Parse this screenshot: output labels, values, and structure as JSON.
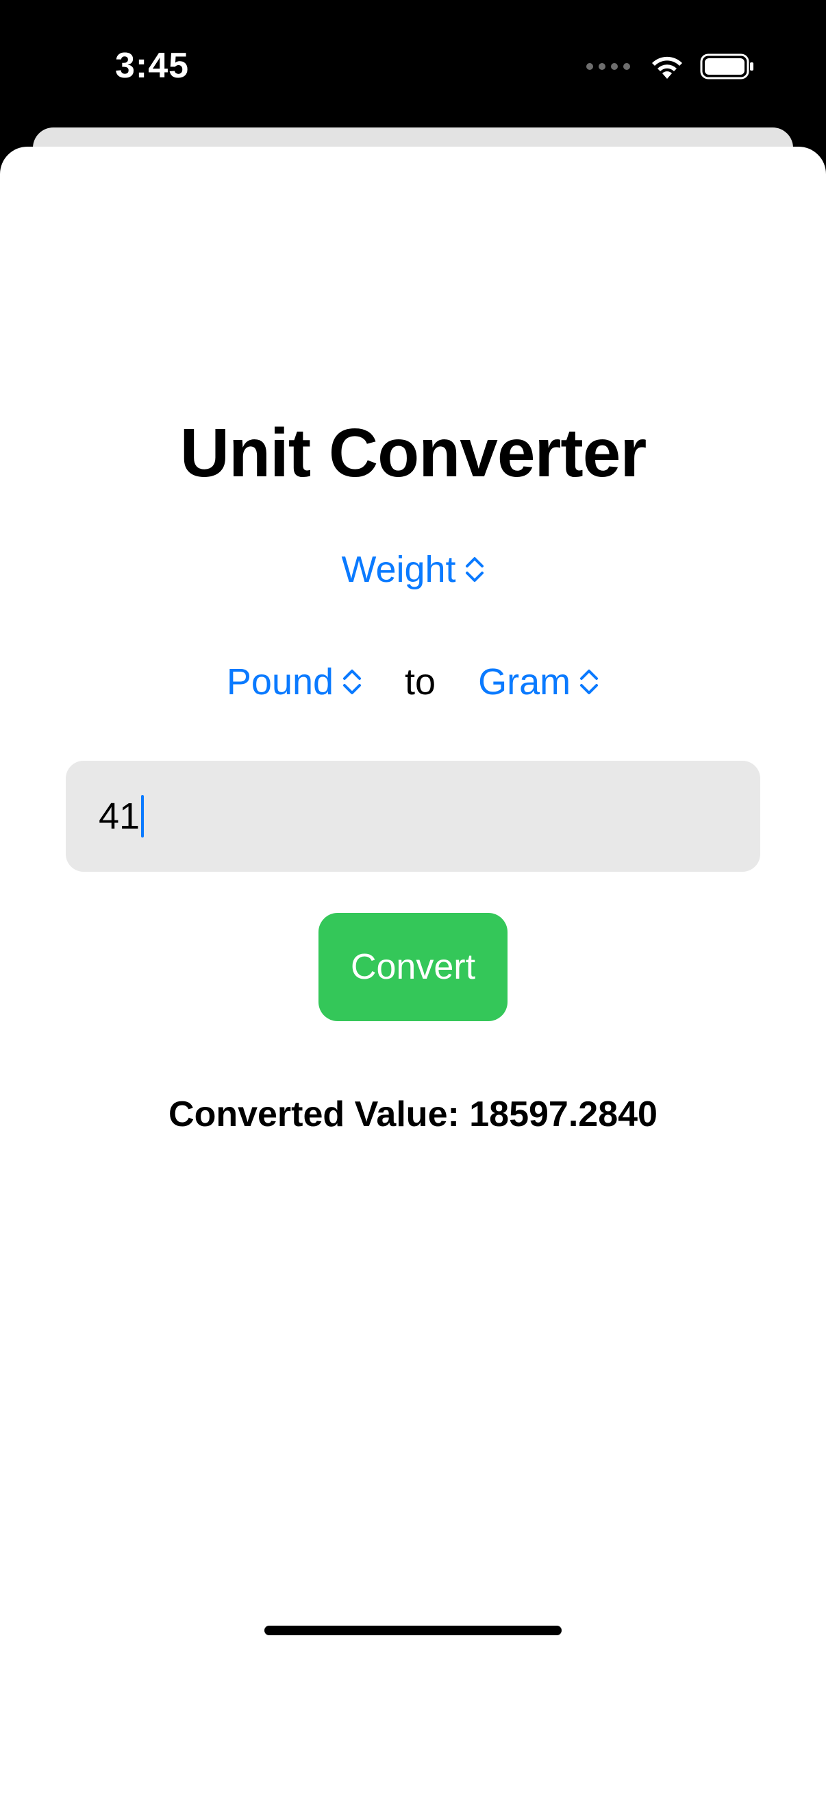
{
  "status_bar": {
    "time": "3:45",
    "icons": [
      "signal-dots-icon",
      "wifi-icon",
      "battery-icon"
    ]
  },
  "main": {
    "title": "Unit Converter",
    "category_picker": {
      "selected": "Weight",
      "icon": "chevron-up-down-icon"
    },
    "from_unit_picker": {
      "selected": "Pound",
      "icon": "chevron-up-down-icon"
    },
    "to_label": "to",
    "to_unit_picker": {
      "selected": "Gram",
      "icon": "chevron-up-down-icon"
    },
    "amount_input": {
      "value": "41"
    },
    "convert_button": {
      "label": "Convert"
    },
    "result_text": "Converted Value: 18597.2840"
  },
  "colors": {
    "accent": "#0A7AFF",
    "button": "#34C759",
    "input_background": "#E8E8E8",
    "status_bar_background": "#000000"
  }
}
